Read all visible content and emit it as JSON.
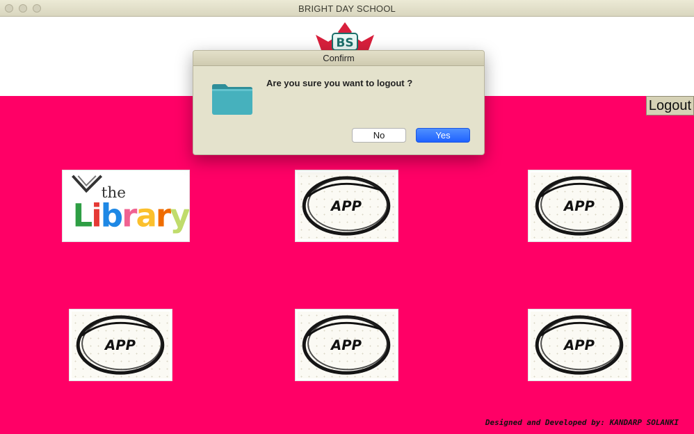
{
  "window": {
    "title": "BRIGHT DAY SCHOOL"
  },
  "header": {
    "logo_text": "BS"
  },
  "main": {
    "logout_label": "Logout",
    "tiles": [
      {
        "name": "library",
        "top_text": "the",
        "main_text": "Library"
      },
      {
        "name": "app",
        "label": "APP"
      },
      {
        "name": "app",
        "label": "APP"
      },
      {
        "name": "app",
        "label": "APP"
      },
      {
        "name": "app",
        "label": "APP"
      },
      {
        "name": "app",
        "label": "APP"
      }
    ],
    "footer_credit": "Designed and Developed by: KANDARP SOLANKI"
  },
  "dialog": {
    "title": "Confirm",
    "message": "Are you sure you want to logout ?",
    "no_label": "No",
    "yes_label": "Yes",
    "icon": "folder-icon"
  },
  "colors": {
    "main_background": "#ff0066",
    "dialog_background": "#e4e2cc",
    "primary_button": "#2a6dff",
    "folder": "#3fa8b4"
  }
}
